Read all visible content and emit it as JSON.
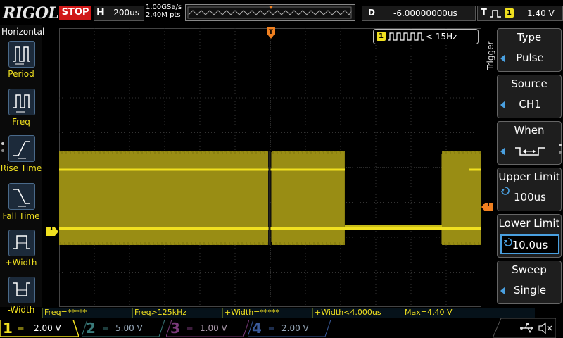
{
  "header": {
    "brand": "RIGOL",
    "run_state": "STOP",
    "timebase_label": "H",
    "timebase_value": "200us",
    "sample_rate": "1.00GSa/s",
    "memory_depth": "2.40M pts",
    "delay_label": "D",
    "delay_value": "-6.00000000us",
    "trigger_label": "T",
    "trigger_channel": "1",
    "trigger_level": "1.40 V"
  },
  "left_menu": {
    "title": "Horizontal",
    "items": [
      {
        "label": "Period",
        "icon": "period-icon"
      },
      {
        "label": "Freq",
        "icon": "freq-icon"
      },
      {
        "label": "Rise Time",
        "icon": "rise-time-icon"
      },
      {
        "label": "Fall Time",
        "icon": "fall-time-icon"
      },
      {
        "label": "+Width",
        "icon": "plus-width-icon"
      },
      {
        "label": "-Width",
        "icon": "minus-width-icon"
      }
    ]
  },
  "trigger_status": {
    "channel": "1",
    "text": "< 15Hz"
  },
  "right_menu": {
    "side_label": "Trigger",
    "items": [
      {
        "title": "Type",
        "value": "Pulse"
      },
      {
        "title": "Source",
        "value": "CH1"
      },
      {
        "title": "When",
        "value": "⊐<→⊏"
      },
      {
        "title": "Upper Limit",
        "value": "100us"
      },
      {
        "title": "Lower Limit",
        "value": "10.0us"
      },
      {
        "title": "Sweep",
        "value": "Single"
      }
    ]
  },
  "measurements": [
    "Freq=*****",
    "Freq>125kHz",
    "+Width=*****",
    "+Width<4.000us",
    "Max=4.40 V"
  ],
  "channels": [
    {
      "num": "1",
      "scale": "2.00 V",
      "color": "#f0e020"
    },
    {
      "num": "2",
      "scale": "5.00 V",
      "color": "#3a7a7a"
    },
    {
      "num": "3",
      "scale": "1.00 V",
      "color": "#7a3a7a"
    },
    {
      "num": "4",
      "scale": "2.00 V",
      "color": "#3a5a9a"
    }
  ],
  "markers": {
    "channel1": "1",
    "trigger": "T"
  },
  "colors": {
    "ch1": "#f0e020",
    "accent": "#4aa0e0",
    "stop": "#d01818",
    "trigger_marker": "#f08020"
  }
}
